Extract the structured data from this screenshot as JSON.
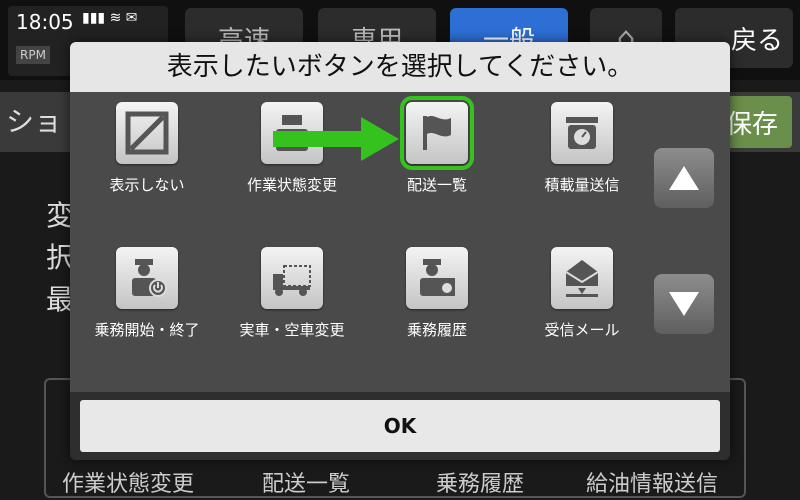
{
  "status": {
    "time": "18:05",
    "rpm_label": "RPM"
  },
  "background": {
    "tabs": [
      "高速",
      "専用",
      "一般"
    ],
    "back_label": "戻る",
    "shortcut_label": "ショ",
    "save_label": "保存",
    "text_lines": [
      "変",
      "択",
      "最"
    ],
    "bottom_buttons": [
      "作業状態変更",
      "配送一覧",
      "乗務履歴",
      "給油情報送信"
    ]
  },
  "dialog": {
    "title": "表示したいボタンを選択してください。",
    "tiles": [
      {
        "label": "表示しない",
        "icon": "no-display-icon"
      },
      {
        "label": "作業状態変更",
        "icon": "worker-icon"
      },
      {
        "label": "配送一覧",
        "icon": "flag-icon",
        "selected": true
      },
      {
        "label": "積載量送信",
        "icon": "scale-icon"
      },
      {
        "label": "乗務開始・終了",
        "icon": "driver-power-icon"
      },
      {
        "label": "実車・空車変更",
        "icon": "truck-icon"
      },
      {
        "label": "乗務履歴",
        "icon": "driver-history-icon"
      },
      {
        "label": "受信メール",
        "icon": "mail-receive-icon"
      }
    ],
    "ok_label": "OK"
  },
  "colors": {
    "selected_outline": "#35c21f",
    "arrow": "#35c21f",
    "accent_tab": "#2d6fd4"
  }
}
